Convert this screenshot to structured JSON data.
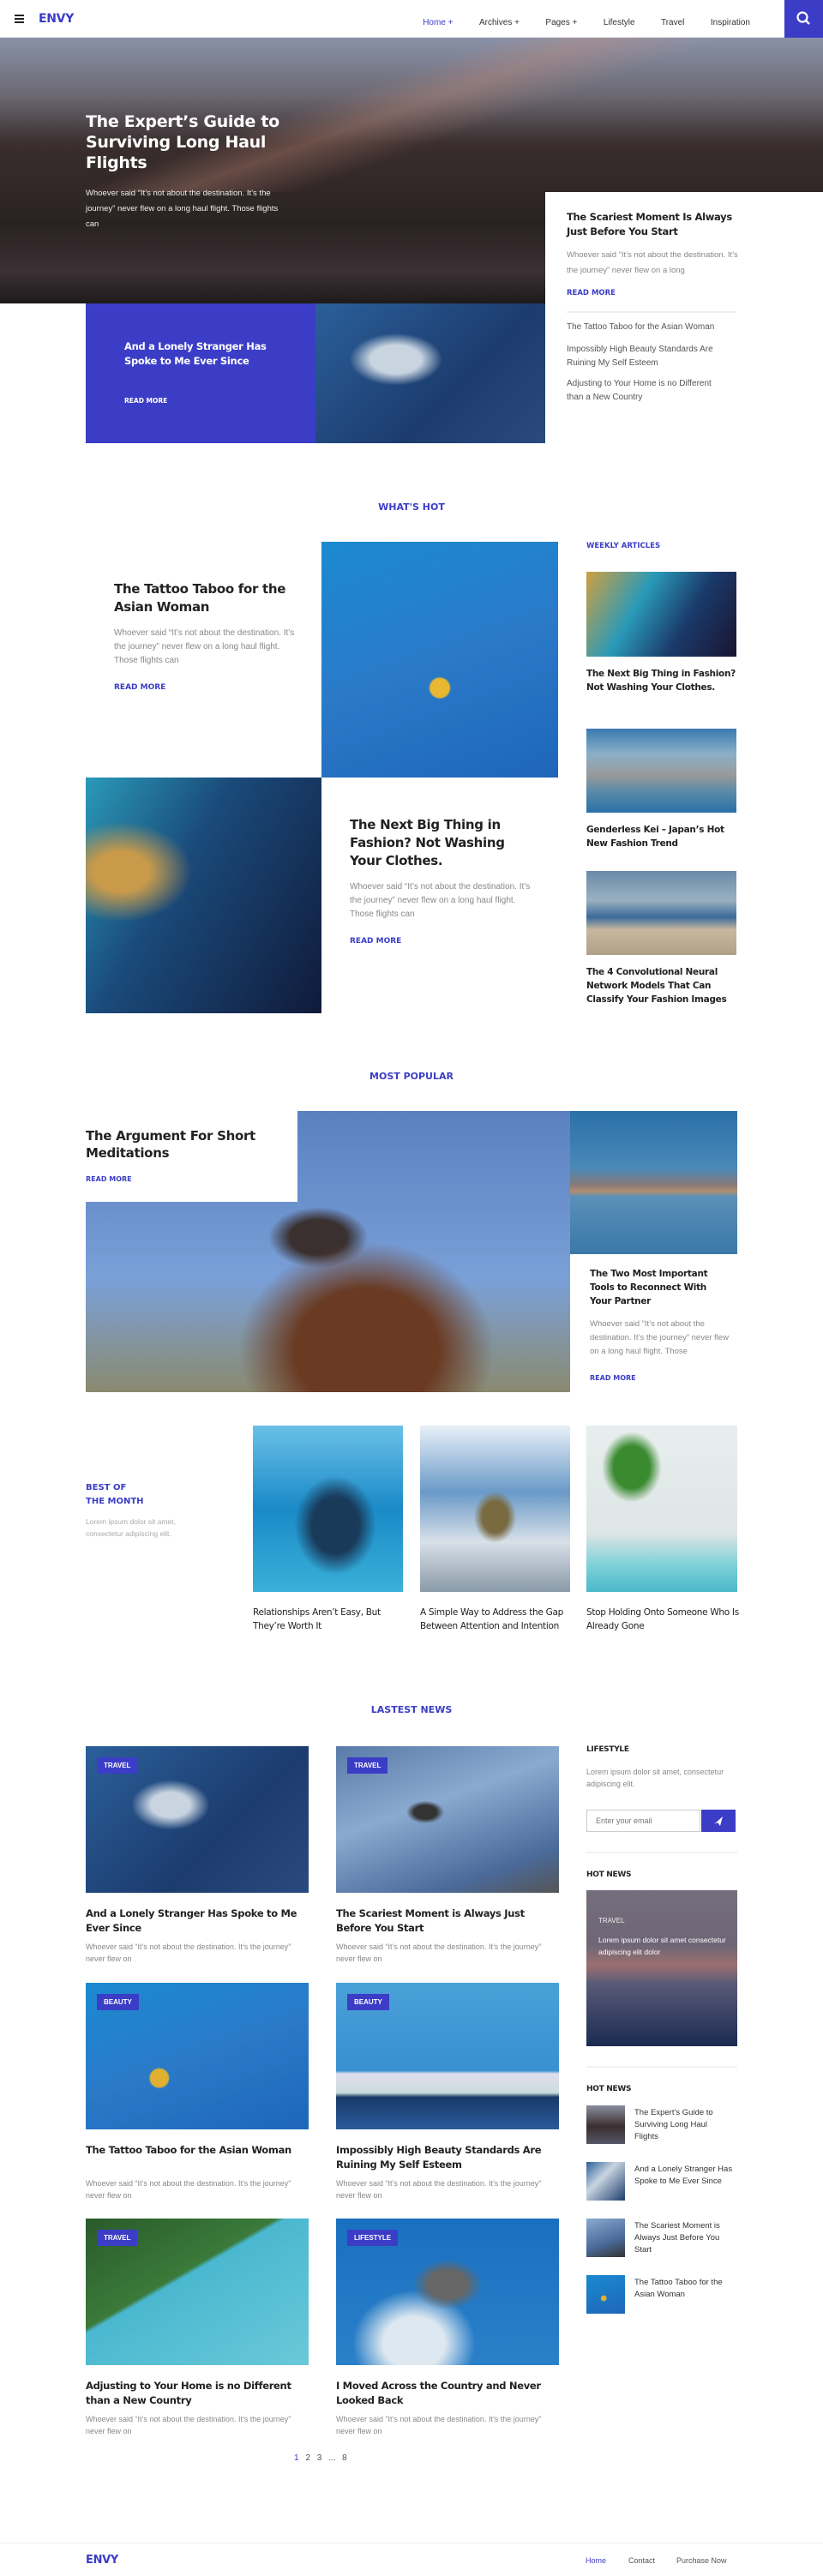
{
  "colors": {
    "accent": "#3b3dc7"
  },
  "header": {
    "logo": "ENVY",
    "menu_icon": "hamburger-icon",
    "search_icon": "search-icon",
    "nav": [
      {
        "label": "Home",
        "plus": "+"
      },
      {
        "label": "Archives",
        "plus": "+"
      },
      {
        "label": "Pages",
        "plus": "+"
      },
      {
        "label": "Lifestyle"
      },
      {
        "label": "Travel"
      },
      {
        "label": "Inspiration"
      }
    ]
  },
  "hero": {
    "title": "The Expert’s Guide to Surviving Long Haul Flights",
    "excerpt": "Whoever said “It’s not about the destination. It’s the journey” never flew on a long haul flight. Those flights can",
    "card": {
      "title": "The Scariest Moment Is Always Just Before You Start",
      "excerpt": "Whoever said “It’s not about the destination. It’s the journey” never flew on a long",
      "read_more": "READ MORE"
    },
    "list": [
      "The Tattoo Taboo for the Asian Woman",
      "Impossibly High Beauty Standards Are Ruining My Self Esteem",
      "Adjusting to Your Home is no Different than a New Country"
    ],
    "blue": {
      "title": "And a Lonely Stranger Has Spoke to Me Ever Since",
      "read_more": "READ MORE"
    }
  },
  "whats_hot": {
    "heading": "WHAT'S HOT",
    "post1": {
      "title": "The Tattoo Taboo for the Asian Woman",
      "excerpt": "Whoever said “It’s not about the destination. It’s the journey” never flew on a long haul flight. Those flights can",
      "read_more": "READ MORE"
    },
    "post2": {
      "title": "The Next Big Thing in Fashion? Not Washing Your Clothes.",
      "excerpt": "Whoever said “It’s not about the destination. It’s the journey” never flew on a long haul flight. Those flights can",
      "read_more": "READ MORE"
    },
    "weekly": {
      "heading": "WEEKLY ARTICLES",
      "items": [
        "The Next Big Thing in Fashion? Not Washing Your Clothes.",
        "Genderless Kei – Japan’s Hot New Fashion Trend",
        "The 4 Convolutional Neural Network Models That Can Classify Your Fashion Images"
      ]
    }
  },
  "most_popular": {
    "heading": "MOST POPULAR",
    "main": {
      "title": "The Argument For Short Meditations",
      "read_more": "READ MORE"
    },
    "side": {
      "title": "The Two Most Important Tools to Reconnect With Your Partner",
      "excerpt": "Whoever said “It’s not about the destination. It’s the journey” never flew on a long haul flight. Those",
      "read_more": "READ MORE"
    }
  },
  "best_of_month": {
    "heading1": "BEST OF",
    "heading2": "THE MONTH",
    "text": "Lorem ipsum dolor sit amet, consectetur adipiscing elit.",
    "items": [
      "Relationships Aren’t Easy, But They’re Worth It",
      "A Simple Way to Address the Gap Between Attention and Intention",
      "Stop Holding Onto Someone Who Is Already Gone"
    ]
  },
  "latest": {
    "heading": "LASTEST NEWS",
    "posts": [
      {
        "badge": "TRAVEL",
        "title": "And a Lonely Stranger Has Spoke to Me Ever Since",
        "excerpt": "Whoever said “It’s not about the destination. It’s the journey” never flew on"
      },
      {
        "badge": "TRAVEL",
        "title": "The Scariest Moment is Always Just Before You Start",
        "excerpt": "Whoever said “It’s not about the destination. It’s the journey” never flew on"
      },
      {
        "badge": "BEAUTY",
        "title": "The Tattoo Taboo for the Asian Woman",
        "excerpt": "Whoever said “It’s not about the destination. It’s the journey” never flew on"
      },
      {
        "badge": "BEAUTY",
        "title": "Impossibly High Beauty Standards Are Ruining My Self Esteem",
        "excerpt": "Whoever said “It’s not about the destination. It’s the journey” never flew on"
      },
      {
        "badge": "TRAVEL",
        "title": "Adjusting to Your Home is no Different than a New Country",
        "excerpt": "Whoever said “It’s not about the destination. It’s the journey” never flew on"
      },
      {
        "badge": "LIFESTYLE",
        "title": "I Moved Across the Country and Never Looked Back",
        "excerpt": "Whoever said “It’s not about the destination. It’s the journey” never flew on"
      }
    ],
    "pagination": [
      "1",
      "2",
      "3",
      "...",
      "8"
    ],
    "sidebar": {
      "lifestyle_heading": "LIFESTYLE",
      "lifestyle_text": "Lorem ipsum dolor sit amet, consectetur adipiscing elit.",
      "email_placeholder": "Enter your email",
      "send_icon": "paper-plane-icon",
      "hot_heading": "HOT NEWS",
      "hot_card": {
        "badge": "TRAVEL",
        "text": "Lorem ipsum dolor sit amet consectetur adipiscing elit dolor"
      },
      "hot_heading2": "HOT NEWS",
      "hot_list": [
        "The Expert’s Guide to Surviving Long Haul Flights",
        "And a Lonely Stranger Has Spoke to Me Ever Since",
        "The Scariest Moment is Always Just Before You Start",
        "The Tattoo Taboo for the Asian Woman"
      ]
    }
  },
  "footer": {
    "logo": "ENVY",
    "links": [
      "Home",
      "Contact",
      "Purchase Now"
    ]
  }
}
